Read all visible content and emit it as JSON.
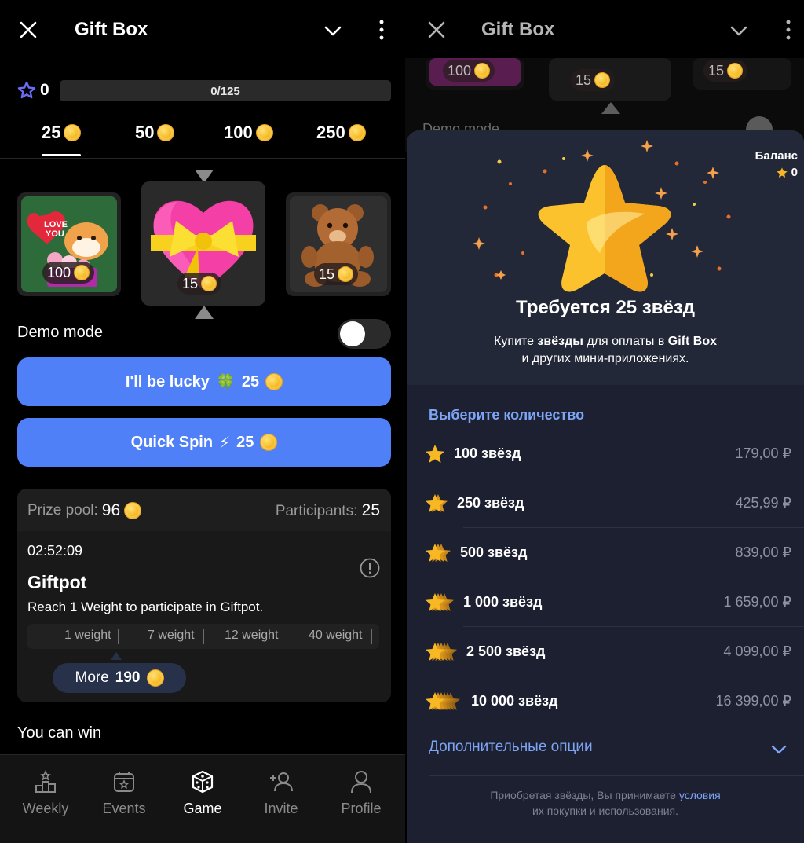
{
  "left": {
    "header": {
      "title": "Gift Box"
    },
    "stars": {
      "count": "0",
      "progress_text": "0/125",
      "progress": 0
    },
    "tiers": [
      {
        "value": "25",
        "active": true
      },
      {
        "value": "50",
        "active": false
      },
      {
        "value": "100",
        "active": false
      },
      {
        "value": "250",
        "active": false
      }
    ],
    "gifts": [
      {
        "name": "love-you-shiba-gift",
        "price": "100"
      },
      {
        "name": "heart-with-bow-gift",
        "price": "15"
      },
      {
        "name": "teddy-bear-gift",
        "price": "15"
      }
    ],
    "demo_mode": {
      "label": "Demo mode",
      "enabled": false
    },
    "lucky_button": {
      "label": "I'll be lucky",
      "icon": "🍀",
      "price": "25"
    },
    "quick_spin_button": {
      "label": "Quick Spin",
      "icon": "⚡",
      "price": "25"
    },
    "pool": {
      "prize_label": "Prize pool:",
      "prize_value": "96",
      "participants_label": "Participants:",
      "participants_value": "25",
      "timer": "02:52:09",
      "title": "Giftpot",
      "description": "Reach 1 Weight to participate in Giftpot.",
      "weights": [
        "1 weight",
        "7 weight",
        "12 weight",
        "40 weight"
      ],
      "more_label": "More",
      "more_value": "190"
    },
    "you_can_win": "You can win",
    "nav": [
      {
        "label": "Weekly",
        "icon": "weekly-icon"
      },
      {
        "label": "Events",
        "icon": "events-icon"
      },
      {
        "label": "Game",
        "icon": "dice-icon",
        "active": true
      },
      {
        "label": "Invite",
        "icon": "invite-icon"
      },
      {
        "label": "Profile",
        "icon": "profile-icon"
      }
    ]
  },
  "right": {
    "header": {
      "title": "Gift Box"
    },
    "bg_prices": [
      "100",
      "15",
      "15"
    ],
    "bg_demo": "Demo mode",
    "balance": {
      "label": "Баланс",
      "value": "0"
    },
    "required": "Требуется 25 звёзд",
    "subtitle_line1_a": "Купите ",
    "subtitle_line1_b": "звёзды",
    "subtitle_line1_c": " для оплаты в ",
    "subtitle_line1_d": "Gift Box",
    "subtitle_line2": "и других мини-приложениях.",
    "choose": "Выберите количество",
    "options": [
      {
        "label": "100 звёзд",
        "price": "179,00 ₽",
        "stars": 1
      },
      {
        "label": "250 звёзд",
        "price": "425,99 ₽",
        "stars": 2
      },
      {
        "label": "500 звёзд",
        "price": "839,00 ₽",
        "stars": 3
      },
      {
        "label": "1 000 звёзд",
        "price": "1 659,00 ₽",
        "stars": 4
      },
      {
        "label": "2 500 звёзд",
        "price": "4 099,00 ₽",
        "stars": 5
      },
      {
        "label": "10 000 звёзд",
        "price": "16 399,00 ₽",
        "stars": 6
      }
    ],
    "more_options": "Дополнительные опции",
    "terms_a": "Приобретая звёзды, Вы принимаете ",
    "terms_link": "условия",
    "terms_b": "их покупки и использования."
  },
  "colors": {
    "accent_blue": "#4f80f7",
    "link_blue": "#7ea4f5",
    "coin_gold": "#f6b91f",
    "sheet_bg": "#232838"
  }
}
